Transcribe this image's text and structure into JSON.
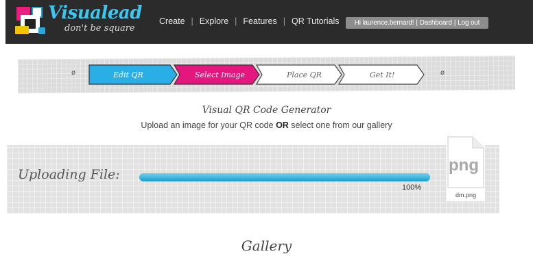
{
  "brand": {
    "name": "Visualead",
    "tagline": "don't be square"
  },
  "nav": {
    "items": [
      "Create",
      "Explore",
      "Features",
      "QR Tutorials"
    ]
  },
  "user": {
    "greeting": "Hi laurence.bernard!",
    "dashboard": "Dashboard",
    "logout": "Log out"
  },
  "steps": [
    {
      "label": "Edit QR",
      "state": "done",
      "color": "#2aaee6"
    },
    {
      "label": "Select Image",
      "state": "active",
      "color": "#e4177f"
    },
    {
      "label": "Place QR",
      "state": "pending"
    },
    {
      "label": "Get It!",
      "state": "pending"
    }
  ],
  "generator": {
    "title": "Visual QR Code Generator",
    "subtitle_before": "Upload an image for your QR code ",
    "subtitle_bold": "OR",
    "subtitle_after": " select one from our gallery"
  },
  "upload": {
    "label": "Uploading File:",
    "progress": 100,
    "progress_text": "100%",
    "file_ext": "png",
    "file_name": "dm.png"
  },
  "gallery": {
    "title": "Gallery"
  }
}
